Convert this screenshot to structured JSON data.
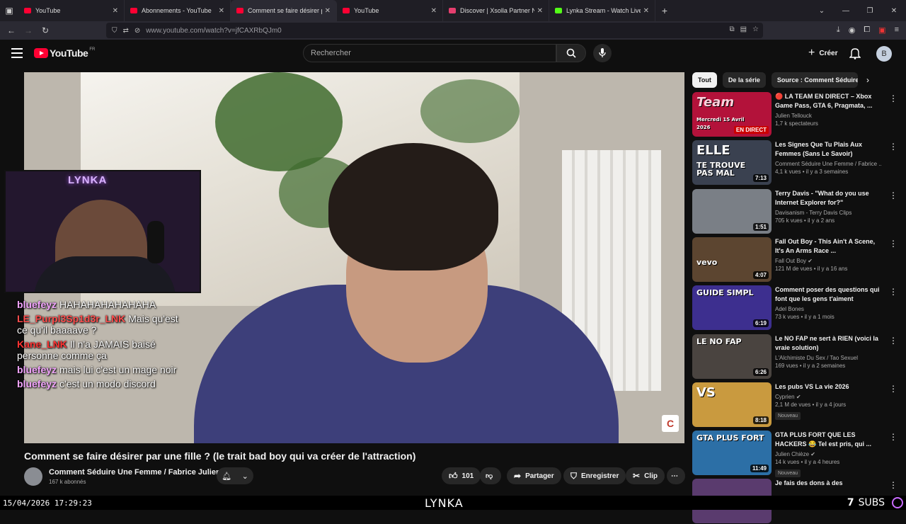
{
  "browser": {
    "tabs": [
      {
        "label": "YouTube",
        "fav_color": "#ff0033",
        "active": false
      },
      {
        "label": "Abonnements - YouTube",
        "fav_color": "#ff0033",
        "active": false
      },
      {
        "label": "Comment se faire désirer par u",
        "fav_color": "#ff0033",
        "active": true
      },
      {
        "label": "YouTube",
        "fav_color": "#ff0033",
        "active": false
      },
      {
        "label": "Discover | Xsolla Partner Netwo",
        "fav_color": "#e53e6e",
        "active": false
      },
      {
        "label": "Lynka Stream - Watch Live on K",
        "fav_color": "#53fc18",
        "active": false
      }
    ],
    "url": "www.youtube.com/watch?v=jfCAXRbQJm0"
  },
  "yt_header": {
    "logo_text": "YouTube",
    "country": "FR",
    "search_placeholder": "Rechercher",
    "create_label": "Créer",
    "avatar_letter": "B"
  },
  "overlay": {
    "webcam_sign": "LYNKA",
    "chat": [
      {
        "user": "bluefeyz",
        "text": "HAHAHAHAHAHAHA",
        "color": "#f4a6ff"
      },
      {
        "user": "LE_Purpl3Sp1d3r_LNK",
        "text": "Mais qu'est ce qu'il baaaave ?",
        "color": "#ff4d4d"
      },
      {
        "user": "Kane_LNK",
        "text": "Il n'a JAMAIS baisé personne comme ça",
        "color": "#ff3333"
      },
      {
        "user": "bluefeyz",
        "text": "mais lui c'est un mage noir",
        "color": "#f4a6ff"
      },
      {
        "user": "bluefeyz",
        "text": "c'est un modo discord",
        "color": "#f4a6ff"
      }
    ]
  },
  "video": {
    "title": "Comment se faire désirer par une fille ? (le trait bad boy qui va créer de l'attraction)",
    "channel": "Comment Séduire Une Femme / Fabrice Julien",
    "subscribers": "167 k abonnés",
    "likes": "101",
    "share_label": "Partager",
    "save_label": "Enregistrer",
    "clip_label": "Clip"
  },
  "chips": [
    "Tout",
    "De la série",
    "Source : Comment Séduire U"
  ],
  "recommendations": [
    {
      "title": "🔴 LA TEAM EN DIRECT – Xbox Game Pass, GTA 6, Pragmata, ...",
      "channel": "Julien Tellouck",
      "meta": "1,7 k spectateurs",
      "duration": "",
      "live": "EN DIRECT",
      "thumb_bg": "#b3123a",
      "thumb_text": "Team",
      "thumb_sub": "Mercredi 15 Avril 2026",
      "verified": false,
      "new": false
    },
    {
      "title": "Les Signes Que Tu Plais Aux Femmes (Sans Le Savoir)",
      "channel": "Comment Séduire Une Femme / Fabrice ...",
      "meta": "4,1 k vues • il y a 3 semaines",
      "duration": "7:13",
      "live": "",
      "thumb_bg": "#3a4150",
      "thumb_text": "ELLE",
      "thumb_sub": "TE TROUVE PAS MAL",
      "verified": false,
      "new": false
    },
    {
      "title": "Terry Davis - \"What do you use Internet Explorer for?\"",
      "channel": "Davisanism - Terry Davis Clips",
      "meta": "705 k vues • il y a 2 ans",
      "duration": "1:51",
      "live": "",
      "thumb_bg": "#7a7f86",
      "thumb_text": "",
      "thumb_sub": "",
      "verified": false,
      "new": false
    },
    {
      "title": "Fall Out Boy - This Ain't A Scene, It's An Arms Race ...",
      "channel": "Fall Out Boy",
      "meta": "121 M de vues • il y a 16 ans",
      "duration": "4:07",
      "live": "",
      "thumb_bg": "#5c4530",
      "thumb_text": "",
      "thumb_sub": "vevo",
      "verified": true,
      "new": false
    },
    {
      "title": "Comment poser des questions qui font que les gens t'aiment",
      "channel": "Adel Bones",
      "meta": "73 k vues • il y a 1 mois",
      "duration": "6:19",
      "live": "",
      "thumb_bg": "#3d2f8f",
      "thumb_text": "GUIDE SIMPL",
      "thumb_sub": "",
      "verified": false,
      "new": false
    },
    {
      "title": "Le NO FAP ne sert à RIEN (voici la vraie solution)",
      "channel": "L'Alchimiste Du Sex / Tao Sexuel",
      "meta": "169 vues • il y a 2 semaines",
      "duration": "6:26",
      "live": "",
      "thumb_bg": "#4a4440",
      "thumb_text": "LE NO FAP",
      "thumb_sub": "",
      "verified": false,
      "new": false
    },
    {
      "title": "Les pubs VS La vie 2026",
      "channel": "Cyprien",
      "meta": "2,1 M de vues • il y a 4 jours",
      "duration": "8:18",
      "live": "",
      "thumb_bg": "#c99a3f",
      "thumb_text": "VS",
      "thumb_sub": "",
      "verified": true,
      "new": true
    },
    {
      "title": "GTA PLUS FORT QUE LES HACKERS 😂 Tel est pris, qui ...",
      "channel": "Julien Chièze",
      "meta": "14 k vues • il y a 4 heures",
      "duration": "11:49",
      "live": "",
      "thumb_bg": "#2c6fa6",
      "thumb_text": "GTA PLUS FORT",
      "thumb_sub": "",
      "verified": true,
      "new": true
    },
    {
      "title": "Je fais des dons à des",
      "channel": "",
      "meta": "",
      "duration": "",
      "live": "",
      "thumb_bg": "#5a3b6e",
      "thumb_text": "",
      "thumb_sub": "",
      "verified": false,
      "new": false
    }
  ],
  "badges": {
    "new_label": "Nouveau"
  },
  "stream_footer": {
    "datetime": "15/04/2026 17:29:23",
    "brand": "LYNKA",
    "subs_count": "7",
    "subs_label": "SUBS"
  }
}
